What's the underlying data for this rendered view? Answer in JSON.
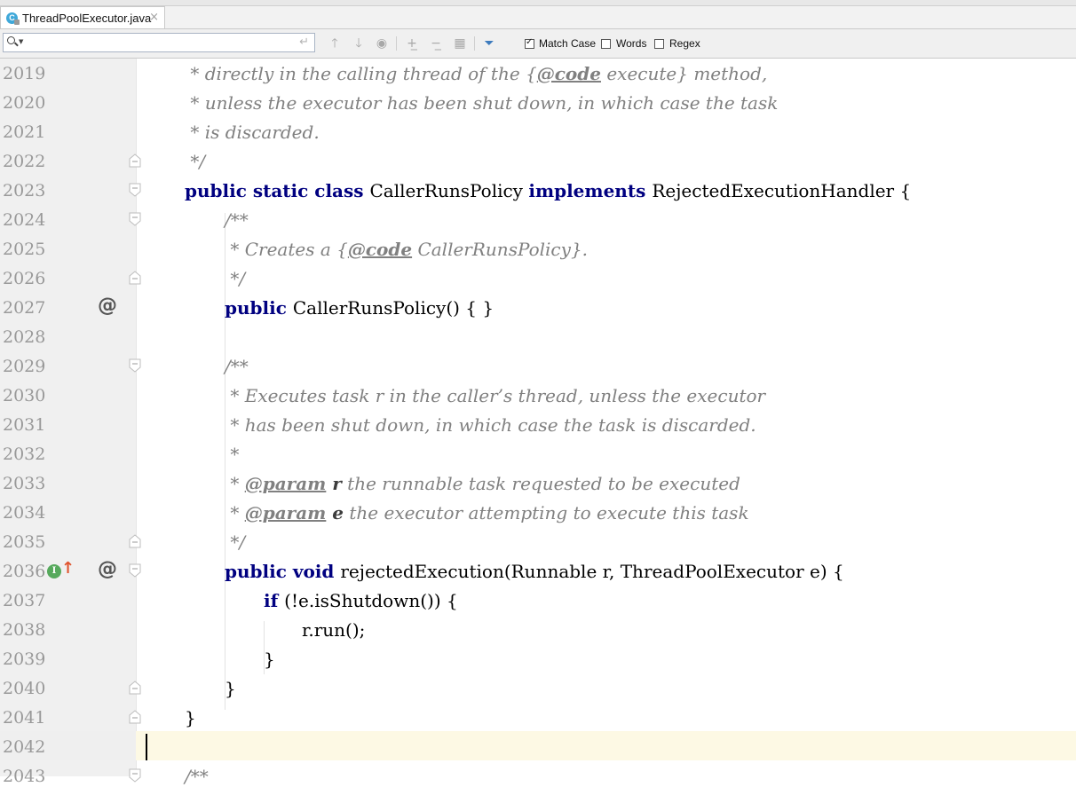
{
  "tab": {
    "icon_letter": "C",
    "label": "ThreadPoolExecutor.java",
    "close": "×"
  },
  "search": {
    "value": "",
    "placeholder": ""
  },
  "options": {
    "match_case": "Match Case",
    "words": "Words",
    "regex": "Regex",
    "match_case_checked": true,
    "words_checked": false,
    "regex_checked": false
  },
  "line_numbers": [
    "2019",
    "2020",
    "2021",
    "2022",
    "2023",
    "2024",
    "2025",
    "2026",
    "2027",
    "2028",
    "2029",
    "2030",
    "2031",
    "2032",
    "2033",
    "2034",
    "2035",
    "2036",
    "2037",
    "2038",
    "2039",
    "2040",
    "2041",
    "2042",
    "2043"
  ],
  "code": {
    "l2019": {
      "a": " * directly in the calling thread of the ",
      "b": "{",
      "tag": "@code",
      "c": " execute",
      "d": "}",
      "e": " method,"
    },
    "l2020": " * unless the executor has been shut down, in which case the task",
    "l2021": " * is discarded.",
    "l2022": " */",
    "l2023": {
      "k1": "public static class ",
      "name": "CallerRunsPolicy ",
      "k2": "implements ",
      "rest": "RejectedExecutionHandler {"
    },
    "l2024": "/**",
    "l2025": {
      "a": " * Creates a ",
      "b": "{",
      "tag": "@code",
      "c": " CallerRunsPolicy",
      "d": "}."
    },
    "l2026": " */",
    "l2027": {
      "k": "public ",
      "rest": "CallerRunsPolicy() { }"
    },
    "l2029": "/**",
    "l2030": " * Executes task r in the caller’s thread, unless the executor",
    "l2031": " * has been shut down, in which case the task is discarded.",
    "l2032": " *",
    "l2033": {
      "a": " * ",
      "tag": "@param",
      "p": " r",
      "rest": " the runnable task requested to be executed"
    },
    "l2034": {
      "a": " * ",
      "tag": "@param",
      "p": " e",
      "rest": " the executor attempting to execute this task"
    },
    "l2035": " */",
    "l2036": {
      "k": "public void ",
      "rest": "rejectedExecution(Runnable r, ThreadPoolExecutor e) {"
    },
    "l2037": {
      "k": "if ",
      "rest": "(!e.isShutdown()) {"
    },
    "l2038": "r.run();",
    "l2039": "}",
    "l2040": "}",
    "l2041": "}",
    "l2043": "/**"
  },
  "gutter": {
    "at_symbol": "@",
    "impl_letter": "I",
    "impl_arrow": "↑"
  },
  "colors": {
    "keyword": "#000080",
    "comment": "#808080",
    "gutter": "#f0f0f0",
    "current_line": "#fdf9e4"
  }
}
